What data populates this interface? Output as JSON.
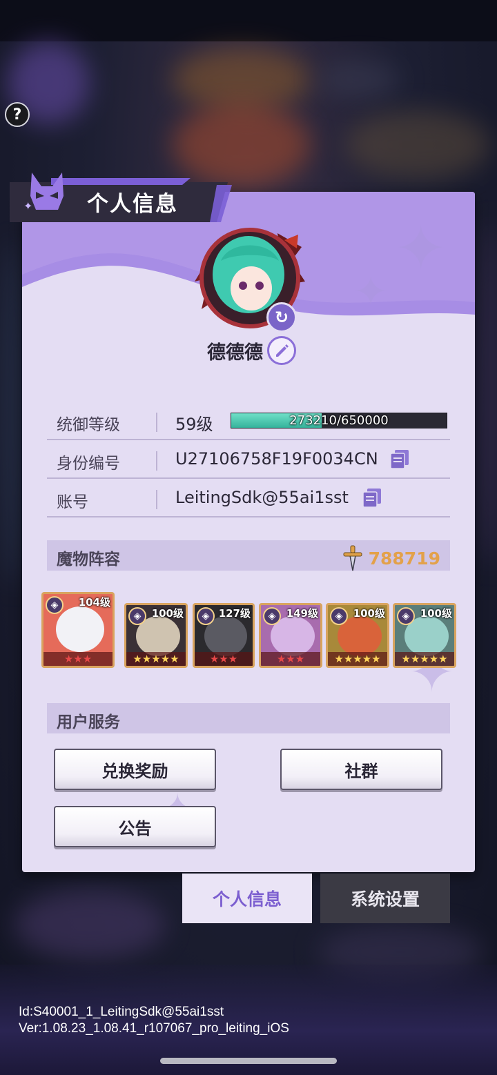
{
  "panel": {
    "title": "个人信息"
  },
  "profile": {
    "nickname": "德德德"
  },
  "info": {
    "level_label": "统御等级",
    "level_value": "59级",
    "xp_text": "273210/650000",
    "xp_fraction": 0.42,
    "id_label": "身份编号",
    "id_value": "U27106758F19F0034CN",
    "account_label": "账号",
    "account_value": "LeitingSdk@55ai1sst"
  },
  "lineup": {
    "title": "魔物阵容",
    "power": "788719",
    "heroes": [
      {
        "level": "104级",
        "stars": "★★★",
        "star_color": "#e84848",
        "bg": "#e56b5a",
        "face": "#f2f2f6"
      },
      {
        "level": "100级",
        "stars": "★★★★★",
        "star_color": "#ffd45a",
        "bg": "#3a3136",
        "face": "#cfc3b0"
      },
      {
        "level": "127级",
        "stars": "★★★",
        "star_color": "#e84848",
        "bg": "#2b2a2e",
        "face": "#5a5a62"
      },
      {
        "level": "149级",
        "stars": "★★★",
        "star_color": "#e84848",
        "bg": "#a86cae",
        "face": "#d7b6e6"
      },
      {
        "level": "100级",
        "stars": "★★★★★",
        "star_color": "#ffd45a",
        "bg": "#a8893a",
        "face": "#d9633a"
      },
      {
        "level": "100级",
        "stars": "★★★★★",
        "star_color": "#ffd45a",
        "bg": "#5b7e7a",
        "face": "#9ad0c9"
      }
    ]
  },
  "service": {
    "title": "用户服务",
    "redeem": "兑换奖励",
    "community": "社群",
    "notice": "公告"
  },
  "tabs": {
    "profile": "个人信息",
    "settings": "系统设置"
  },
  "footer": {
    "id_line": "Id:S40001_1_LeitingSdk@55ai1sst",
    "version_line": "Ver:1.08.23_1.08.41_r107067_pro_leiting_iOS"
  }
}
